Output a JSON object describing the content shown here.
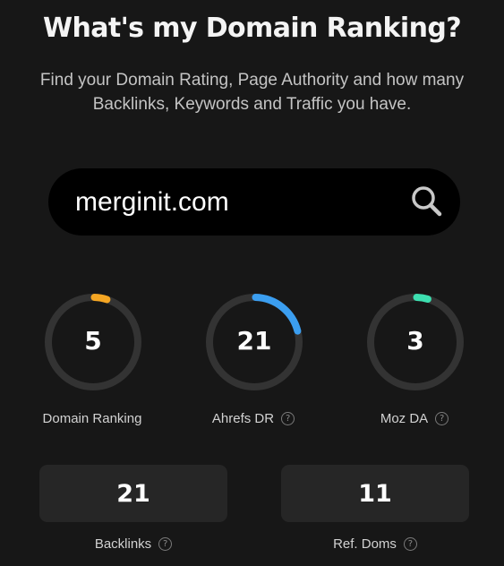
{
  "header": {
    "title": "What's my Domain Ranking?",
    "subtitle_line1": "Find your Domain Rating, Page Authority and how many",
    "subtitle_line2": "Backlinks, Keywords and Traffic you have."
  },
  "search": {
    "value": "merginit.com",
    "icon": "search-icon"
  },
  "metrics": [
    {
      "label": "Domain Ranking",
      "value": "5",
      "score": 5,
      "max": 100,
      "color": "#f5a623",
      "has_help": false
    },
    {
      "label": "Ahrefs DR",
      "value": "21",
      "score": 21,
      "max": 100,
      "color": "#3b9ef0",
      "has_help": true
    },
    {
      "label": "Moz DA",
      "value": "3",
      "score": 3,
      "max": 100,
      "color": "#3ddfb0",
      "has_help": true
    }
  ],
  "stats": [
    {
      "label": "Backlinks",
      "value": "21",
      "has_help": true
    },
    {
      "label": "Ref. Doms",
      "value": "11",
      "has_help": true
    }
  ],
  "help_glyph": "?",
  "colors": {
    "background": "#171717",
    "track": "#333333",
    "search_bg": "#000000",
    "stat_bg": "#262626"
  }
}
